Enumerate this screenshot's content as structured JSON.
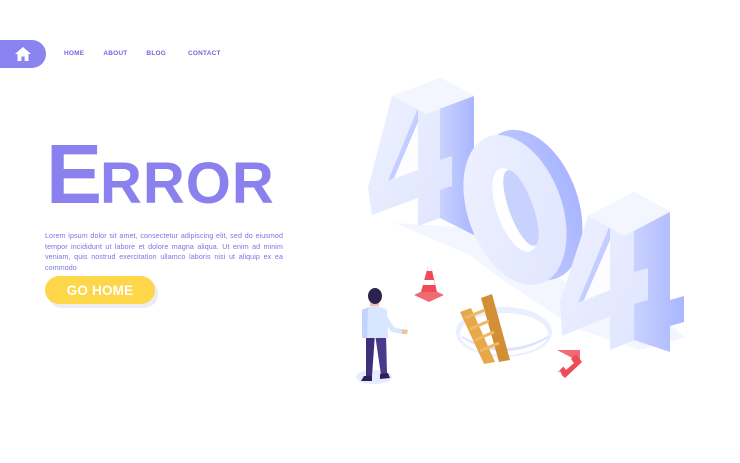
{
  "nav": {
    "home_icon": "home-icon",
    "items": [
      "HOME",
      "ABOUT",
      "BLOG",
      "CONTACT"
    ]
  },
  "hero": {
    "title_initial": "E",
    "title_rest": "RROR",
    "body": "Lorem ipsum dolor sit amet, consectetur adipiscing elit, sed do eiusmod tempor incididunt ut labore et dolore magna aliqua. Ut enim ad minim veniam, quis nostrud exercitation ullamco laboris nisi ut aliquip ex ea commodo",
    "cta_label": "GO HOME"
  },
  "illustration": {
    "big_digits": "404",
    "elements": [
      "person",
      "traffic-cone",
      "ladder",
      "hole",
      "fallen-traffic-cone"
    ]
  },
  "colors": {
    "accent": "#8b83f0",
    "button": "#fdd64a",
    "digits_face": "#e6ebff",
    "digits_side": "#b8c3ff",
    "cone": "#f0606a"
  }
}
